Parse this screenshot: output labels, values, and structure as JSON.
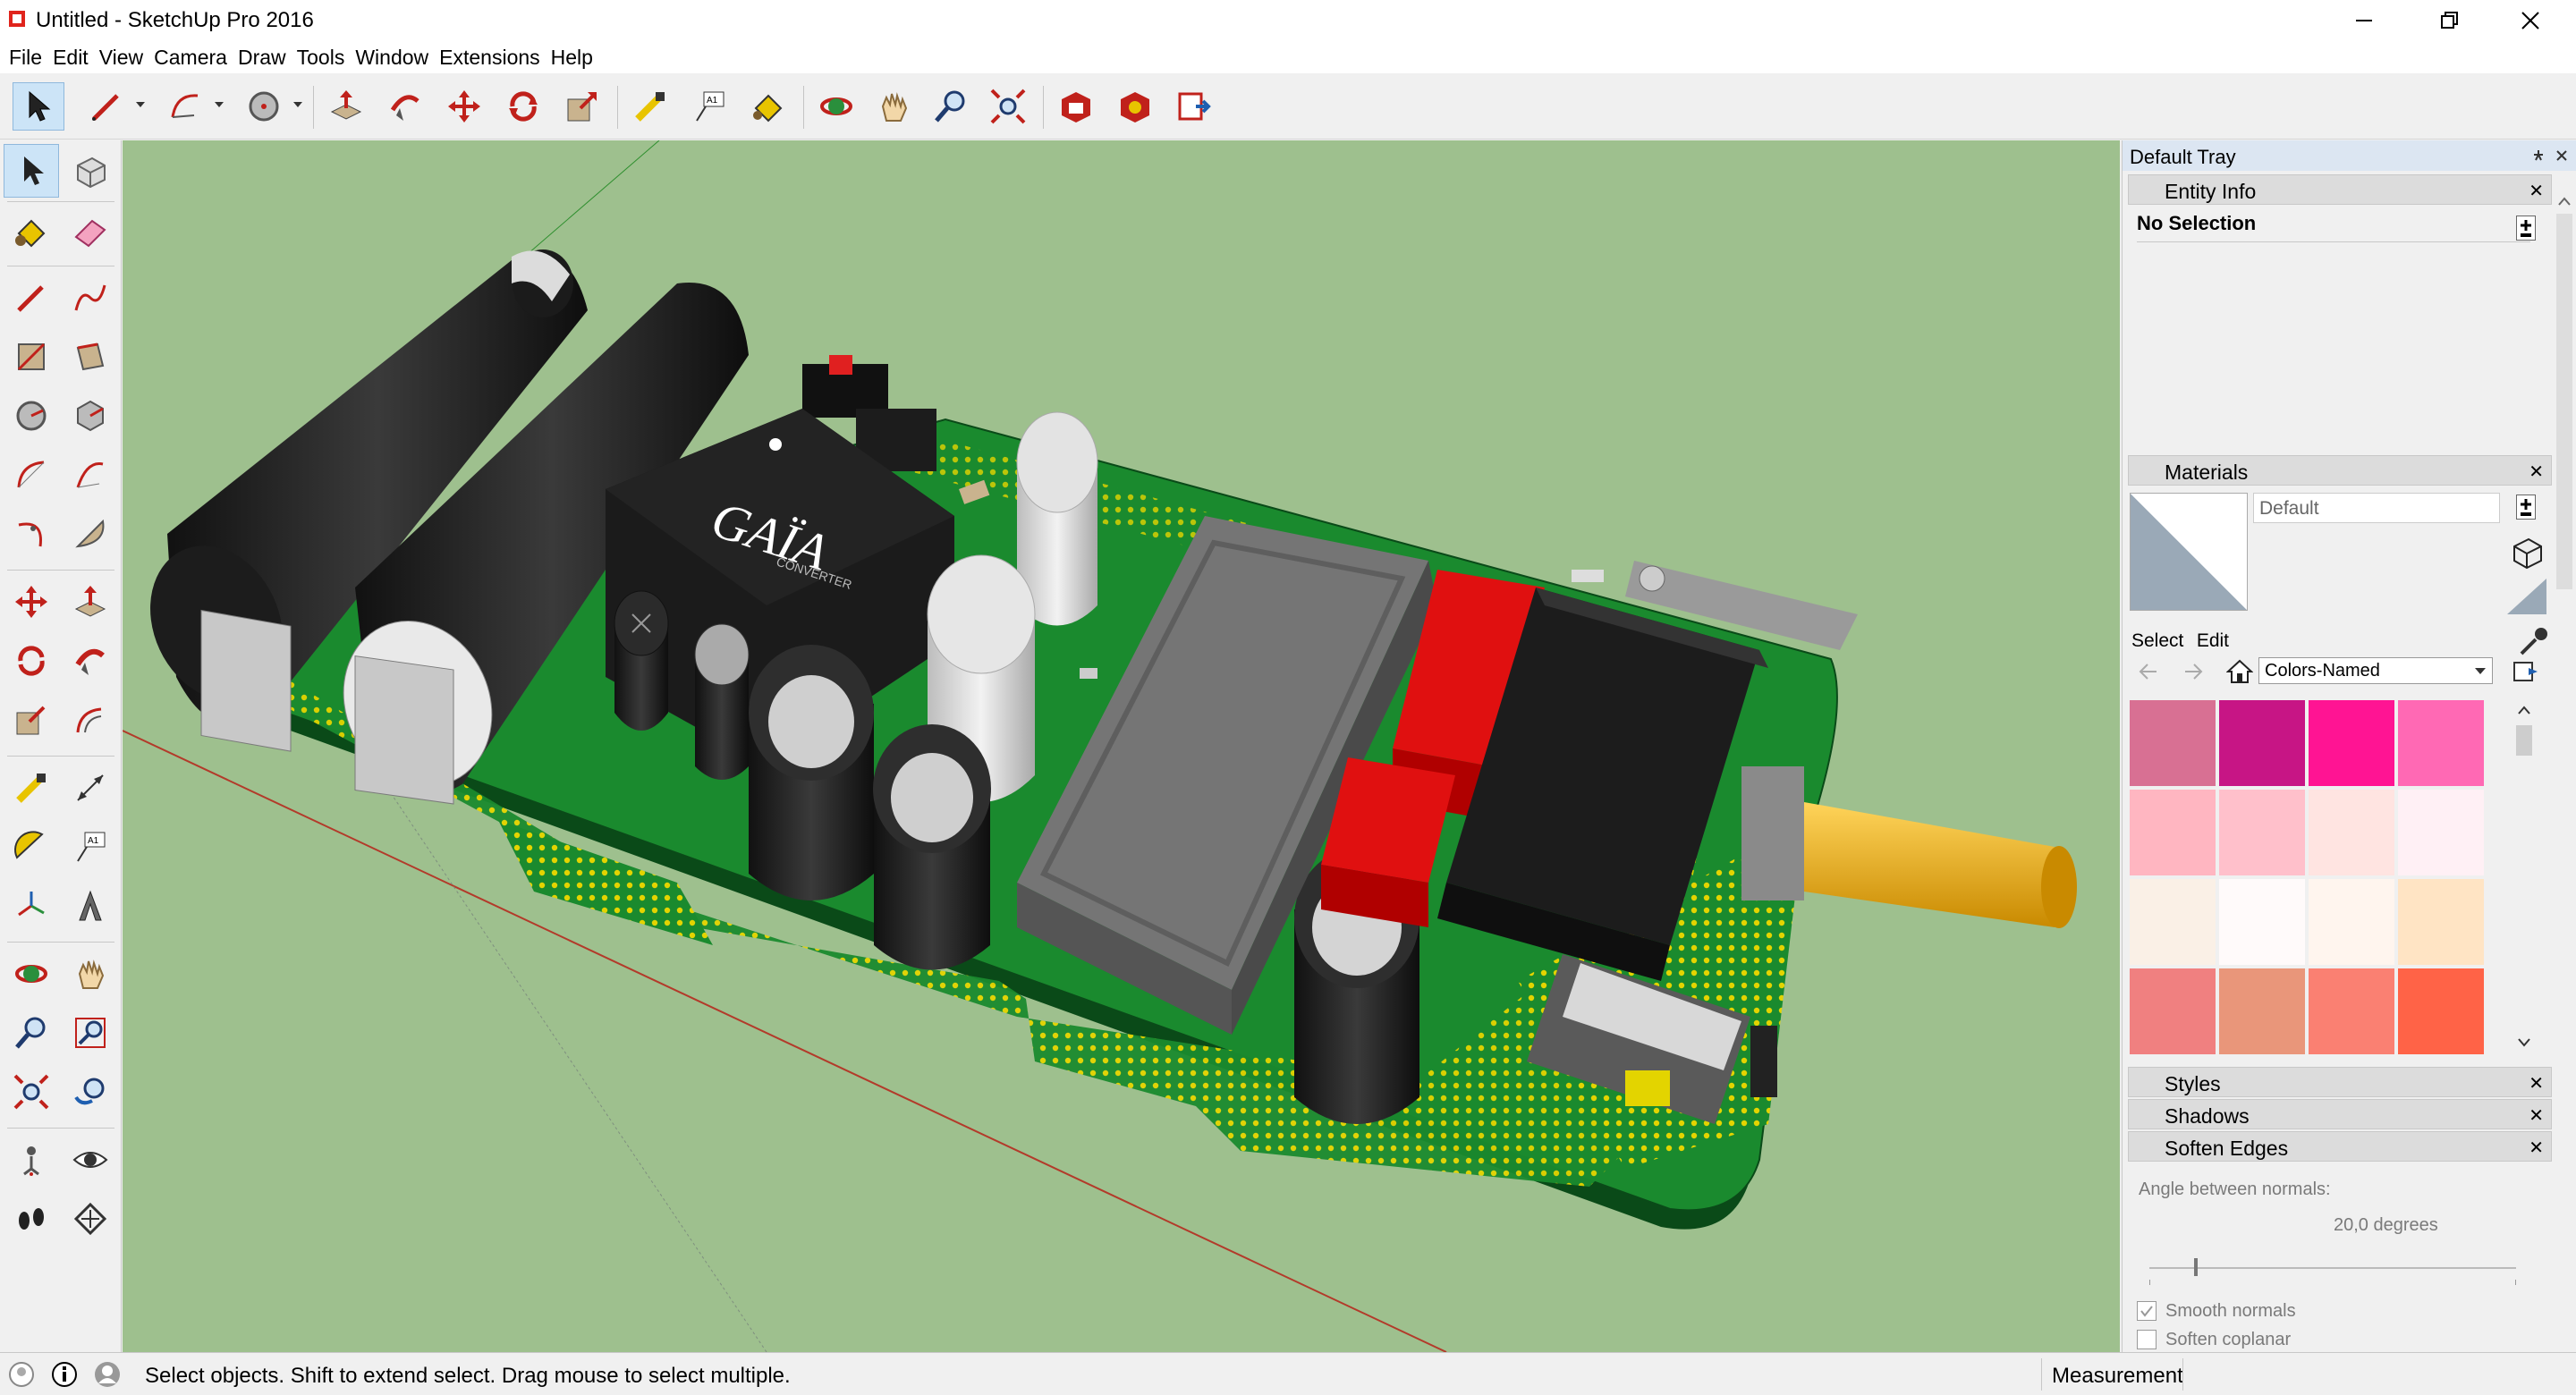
{
  "window": {
    "title": "Untitled - SketchUp Pro 2016"
  },
  "menu": [
    "File",
    "Edit",
    "View",
    "Camera",
    "Draw",
    "Tools",
    "Window",
    "Extensions",
    "Help"
  ],
  "toolbar": {
    "tools": [
      "select-icon",
      "pencil-icon",
      "arc-icon",
      "circle-icon",
      "push-pull-icon",
      "follow-me-icon",
      "move-icon",
      "rotate-icon",
      "scale-icon",
      "tape-measure-icon",
      "text-icon",
      "paint-bucket-icon",
      "orbit-icon",
      "pan-icon",
      "zoom-icon",
      "zoom-extents-icon",
      "warehouse-icon",
      "extension-warehouse-icon",
      "send-to-layout-icon"
    ]
  },
  "left_toolbar": {
    "tools": [
      "select-icon",
      "make-component-icon",
      "paint-bucket-icon",
      "eraser-icon",
      "line-icon",
      "freehand-icon",
      "rectangle-icon",
      "rotated-rectangle-icon",
      "circle-icon",
      "polygon-icon",
      "arc-icon",
      "two-point-arc-icon",
      "three-point-arc-icon",
      "pie-icon",
      "move-icon",
      "push-pull-icon",
      "rotate-icon",
      "follow-me-icon",
      "scale-icon",
      "offset-icon",
      "tape-measure-icon",
      "dimension-icon",
      "protractor-icon",
      "text-icon",
      "axes-icon",
      "3d-text-icon",
      "orbit-icon",
      "pan-icon",
      "zoom-icon",
      "zoom-window-icon",
      "zoom-extents-icon",
      "previous-view-icon",
      "position-camera-icon",
      "look-around-icon",
      "walk-icon",
      "section-plane-icon"
    ]
  },
  "tray": {
    "title": "Default Tray",
    "entity_info": {
      "header": "Entity Info",
      "selection": "No Selection"
    },
    "materials": {
      "header": "Materials",
      "name": "Default",
      "tab_select": "Select",
      "tab_edit": "Edit",
      "library": "Colors-Named",
      "swatches": [
        "#d87093",
        "#c71585",
        "#ff1493",
        "#ff69b4",
        "#ffb6c1",
        "#ffc0cb",
        "#ffe4e1",
        "#fff0f5",
        "#faf0e6",
        "#fffafa",
        "#fff5ee",
        "#ffe4c4",
        "#f08080",
        "#e9967a",
        "#fa8072",
        "#ff6347"
      ]
    },
    "styles": "Styles",
    "shadows": "Shadows",
    "soften_edges": {
      "header": "Soften Edges",
      "angle_label": "Angle between normals:",
      "angle_value": "20,0  degrees",
      "smooth_normals": "Smooth normals",
      "soften_coplanar": "Soften coplanar",
      "smooth_checked": true,
      "coplanar_checked": false
    }
  },
  "viewport": {
    "logo_text": "GAÏA",
    "logo_sub": "CONVERTER"
  },
  "status": {
    "message": "Select objects. Shift to extend select. Drag mouse to select multiple.",
    "measurements_label": "Measurements"
  },
  "colors": {
    "sky_ground": "#9ec08e",
    "pcb_green": "#1a8a2e",
    "accent_blue": "#cce4f7"
  }
}
